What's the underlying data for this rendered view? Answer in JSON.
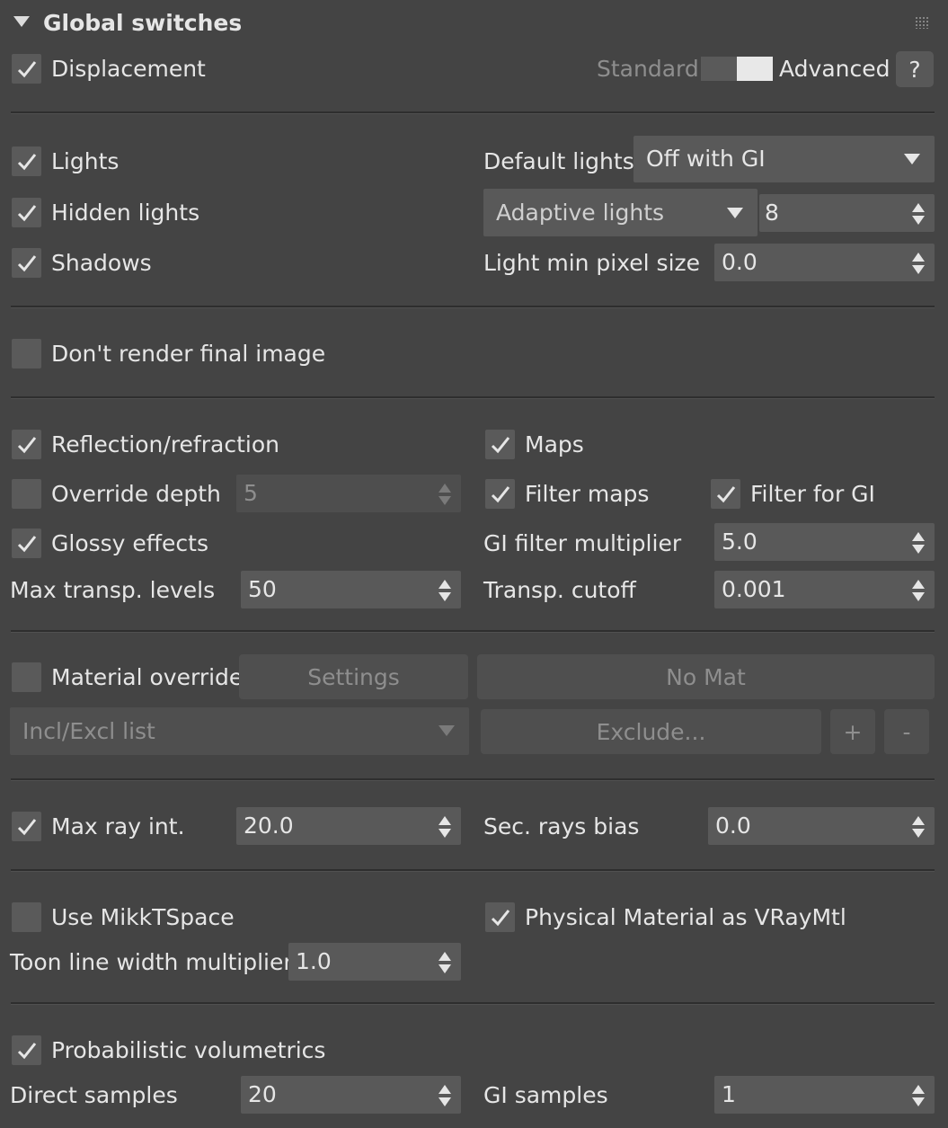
{
  "panel": {
    "title": "Global switches",
    "collapse_icon": "triangle-down-icon",
    "grip_icon": "dots-grid-icon"
  },
  "mode": {
    "standard_label": "Standard",
    "advanced_label": "Advanced",
    "help_label": "?"
  },
  "displacement": {
    "label": "Displacement",
    "checked": true
  },
  "lights": {
    "lights_label": "Lights",
    "hidden_lights_label": "Hidden lights",
    "shadows_label": "Shadows",
    "default_lights_label": "Default lights",
    "default_lights_value": "Off with GI",
    "adaptive_lights_value": "Adaptive lights",
    "adaptive_count": "8",
    "light_min_pixel_label": "Light min pixel size",
    "light_min_pixel_value": "0.0"
  },
  "final_image": {
    "label": "Don't render final image"
  },
  "reflections": {
    "reflection_label": "Reflection/refraction",
    "maps_label": "Maps",
    "override_depth_label": "Override depth",
    "override_depth_value": "5",
    "filter_maps_label": "Filter maps",
    "filter_gi_label": "Filter for GI",
    "glossy_label": "Glossy effects",
    "gi_filter_mult_label": "GI filter multiplier",
    "gi_filter_mult_value": "5.0",
    "max_transp_label": "Max transp. levels",
    "max_transp_value": "50",
    "transp_cutoff_label": "Transp. cutoff",
    "transp_cutoff_value": "0.001"
  },
  "material": {
    "override_label": "Material override",
    "settings_label": "Settings",
    "no_mat_label": "No Mat",
    "incl_excl_value": "Incl/Excl list",
    "exclude_label": "Exclude...",
    "plus_label": "+",
    "minus_label": "-"
  },
  "rays": {
    "max_ray_label": "Max ray int.",
    "max_ray_value": "20.0",
    "sec_rays_label": "Sec. rays bias",
    "sec_rays_value": "0.0"
  },
  "misc": {
    "mikkt_label": "Use MikkTSpace",
    "physical_label": "Physical Material as VRayMtl",
    "toon_label": "Toon line width multiplier",
    "toon_value": "1.0"
  },
  "volumetrics": {
    "label": "Probabilistic volumetrics",
    "direct_label": "Direct samples",
    "direct_value": "20",
    "gi_label": "GI samples",
    "gi_value": "1"
  },
  "colors": {
    "bg": "#444444",
    "field": "#595959",
    "text": "#e6e6e6",
    "dim": "#8e8e8e"
  }
}
